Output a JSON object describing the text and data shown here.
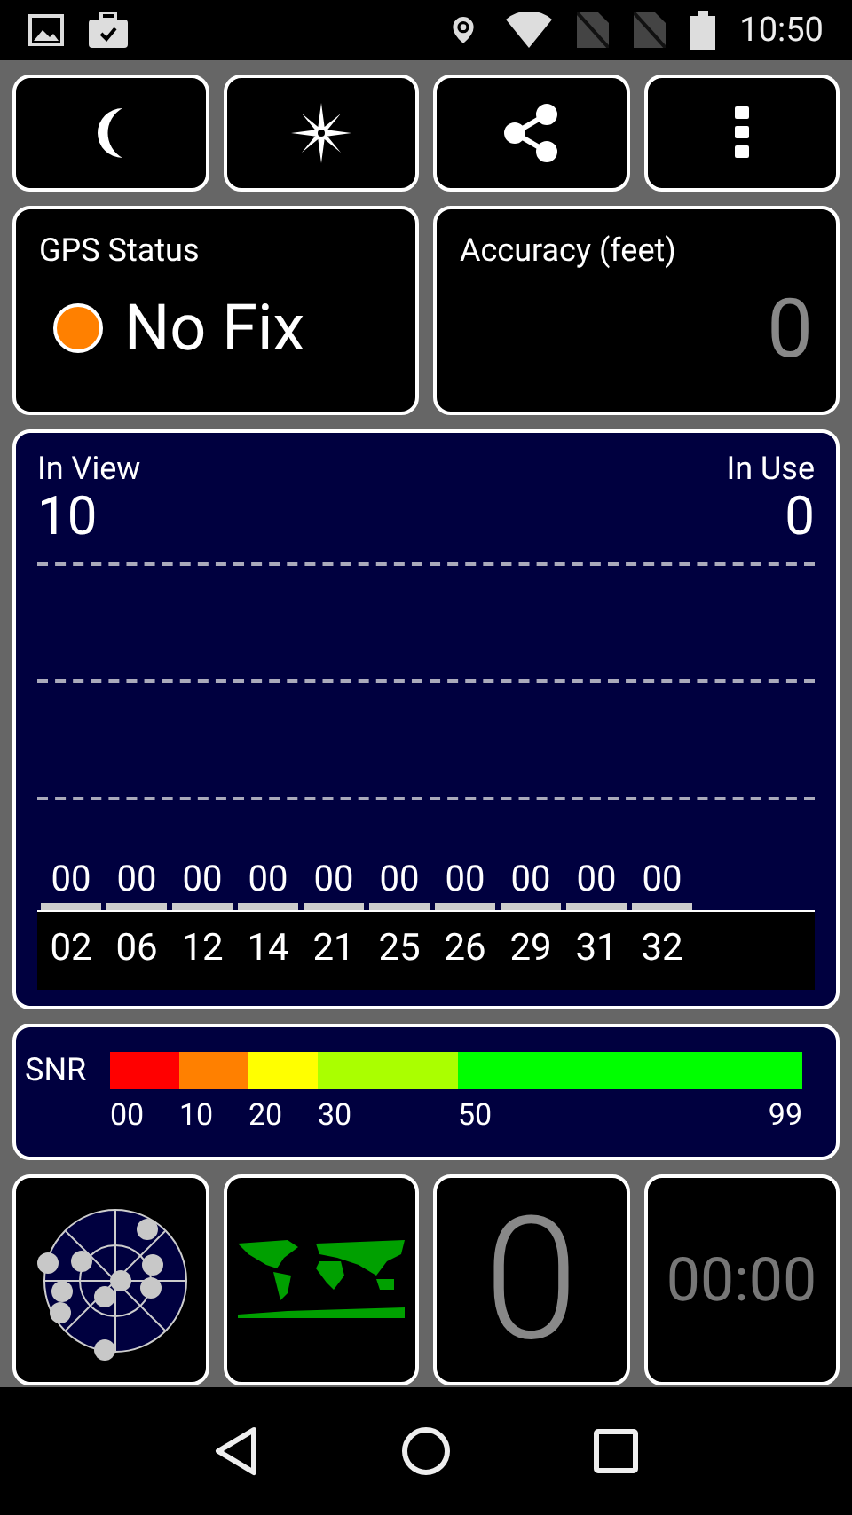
{
  "status_bar": {
    "time": "10:50"
  },
  "toolbar": [
    {
      "kind": "night"
    },
    {
      "kind": "compass"
    },
    {
      "kind": "share"
    },
    {
      "kind": "more"
    }
  ],
  "gps_status": {
    "title": "GPS Status",
    "value": "No Fix",
    "color": "#ff8000"
  },
  "accuracy": {
    "title": "Accuracy (feet)",
    "value": "0"
  },
  "satellites": {
    "in_view_label": "In View",
    "in_view": "10",
    "in_use_label": "In Use",
    "in_use": "0",
    "items": [
      {
        "prn": "02",
        "snr": "00"
      },
      {
        "prn": "06",
        "snr": "00"
      },
      {
        "prn": "12",
        "snr": "00"
      },
      {
        "prn": "14",
        "snr": "00"
      },
      {
        "prn": "21",
        "snr": "00"
      },
      {
        "prn": "25",
        "snr": "00"
      },
      {
        "prn": "26",
        "snr": "00"
      },
      {
        "prn": "29",
        "snr": "00"
      },
      {
        "prn": "31",
        "snr": "00"
      },
      {
        "prn": "32",
        "snr": "00"
      }
    ]
  },
  "snr_scale": {
    "label": "SNR",
    "segments": [
      {
        "label": "00",
        "color": "#ff0000"
      },
      {
        "label": "10",
        "color": "#ff8000"
      },
      {
        "label": "20",
        "color": "#ffff00"
      },
      {
        "label": "30",
        "color": "#aaff00"
      },
      {
        "label": "50",
        "color": "#00ff00"
      }
    ],
    "end_label": "99"
  },
  "tiles": [
    {
      "kind": "radar"
    },
    {
      "kind": "map"
    },
    {
      "kind": "count",
      "value": "0"
    },
    {
      "kind": "timer",
      "value": "00:00"
    }
  ]
}
